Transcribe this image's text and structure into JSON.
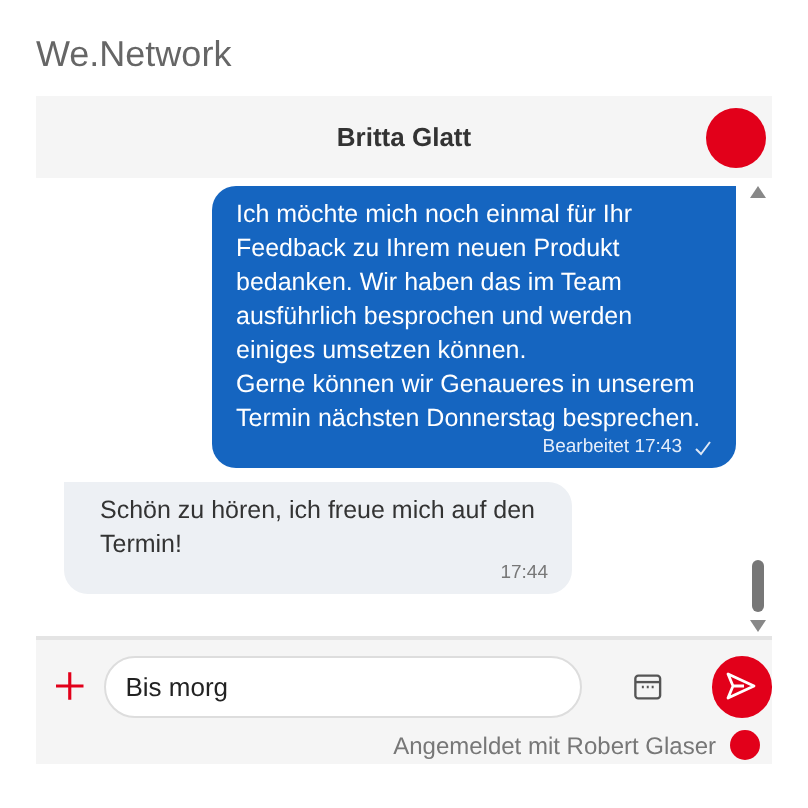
{
  "app_title": "We.Network",
  "chat": {
    "contact_name": "Britta Glatt"
  },
  "messages": [
    {
      "kind": "outgoing",
      "text": "Ich möchte mich noch einmal für Ihr Feedback zu Ihrem neuen Produkt bedanken. Wir haben das im Team ausführlich besprochen und werden einiges umsetzen können.\nGerne können wir Genaueres in unserem Termin nächsten Donnerstag besprechen.",
      "time": "Bearbeitet 17:43",
      "read": true
    },
    {
      "kind": "incoming",
      "text": "Schön zu hören, ich freue mich auf den Termin!",
      "time": "17:44",
      "read": false
    }
  ],
  "composer": {
    "value": "Bis morg"
  },
  "footer": {
    "login_text": "Angemeldet mit Robert Glaser"
  }
}
